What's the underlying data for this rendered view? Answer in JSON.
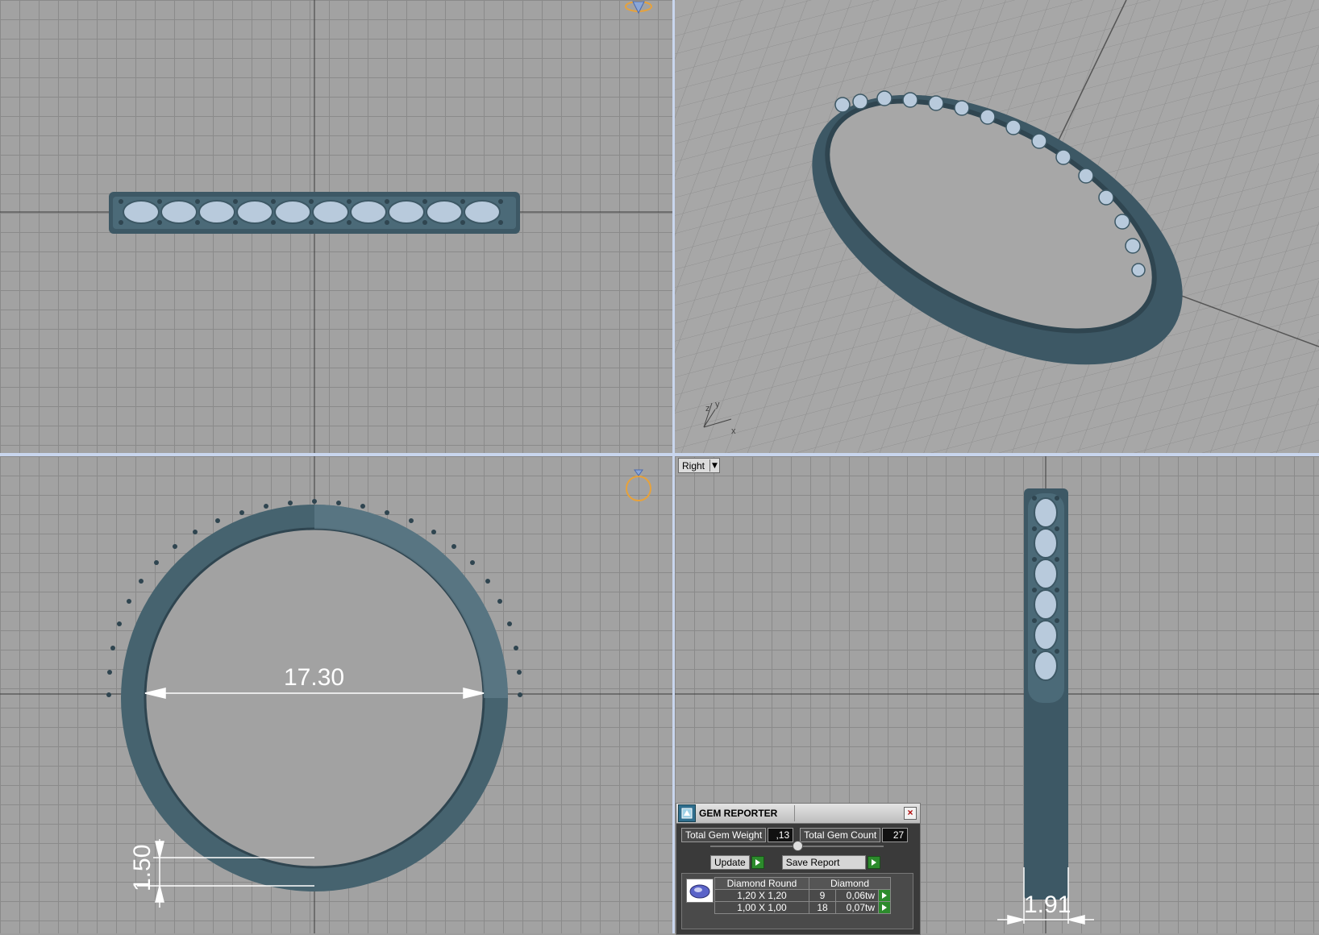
{
  "viewports": {
    "right": {
      "view_label": "Right"
    }
  },
  "dimensions": {
    "inner_diameter": "17.30",
    "band_thickness": "1.50",
    "band_width": "1.91"
  },
  "axis": {
    "x": "x",
    "y": "y",
    "z": "z"
  },
  "gem_reporter": {
    "title": "GEM REPORTER",
    "total_weight_label": "Total Gem Weight",
    "total_weight_value": ",13",
    "total_count_label": "Total Gem Count",
    "total_count_value": "27",
    "update_label": "Update",
    "save_report_label": "Save Report",
    "columns": [
      "Diamond Round",
      "Diamond"
    ],
    "rows": [
      {
        "size": "1,20 X 1,20",
        "count": "9",
        "weight": "0,06tw"
      },
      {
        "size": "1,00 X 1,00",
        "count": "18",
        "weight": "0,07tw"
      }
    ]
  },
  "colors": {
    "metal": "#3f5a67",
    "gem": "#a9bfd6",
    "grid_bg": "#a2a2a2",
    "accent_green": "#2c8b2c",
    "ring_icon": "#e8a23a"
  }
}
